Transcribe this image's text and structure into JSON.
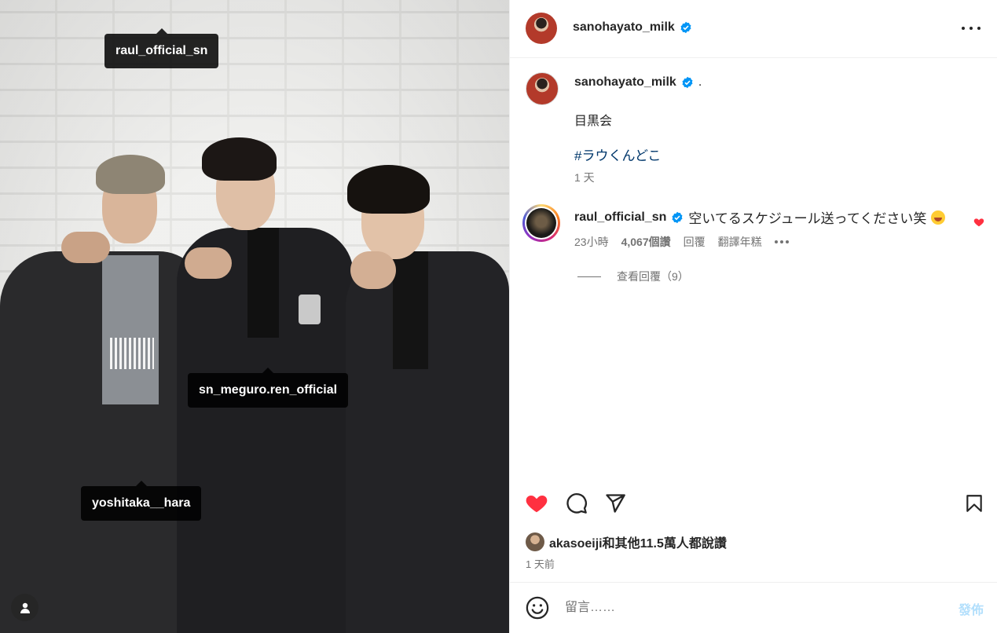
{
  "photo": {
    "tags": [
      {
        "label": "raul_official_sn"
      },
      {
        "label": "sn_meguro.ren_official"
      },
      {
        "label": "yoshitaka__hara"
      }
    ],
    "tag_button_icon": "user-icon"
  },
  "header": {
    "username": "sanohayato_milk",
    "verified_icon": "verified-badge-icon",
    "more_icon": "more-options-icon"
  },
  "caption": {
    "username": "sanohayato_milk",
    "suffix": ".",
    "text": "目黒会",
    "hashtag": "#ラウくんどこ",
    "time": "1 天"
  },
  "comment": {
    "username": "raul_official_sn",
    "text": "空いてるスケジュール送ってください笑",
    "emoji": "grinning-squinting-face-emoji",
    "time": "23小時",
    "likes": "4,067個讚",
    "reply": "回覆",
    "translate": "翻譯年糕",
    "liked": true,
    "view_replies": "查看回覆（9）"
  },
  "actions": {
    "like_icon": "heart-filled-icon",
    "comment_icon": "comment-icon",
    "share_icon": "share-icon",
    "save_icon": "bookmark-icon",
    "like_color": "#ff3040"
  },
  "likes": {
    "text": "akasoeiji和其他11.5萬人都說讚",
    "time": "1 天前"
  },
  "add_comment": {
    "placeholder": "留言……",
    "post_label": "發佈"
  }
}
